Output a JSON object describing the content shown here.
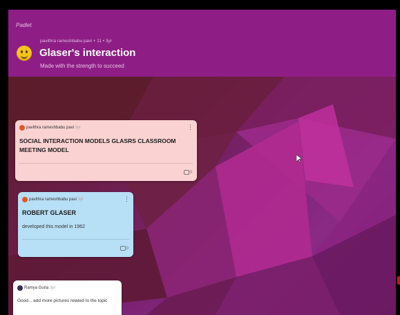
{
  "header": {
    "brand": "Padlet",
    "meta": "pavithra rameshbabu pavi + 11 • 3yr",
    "title": "Glaser's interaction",
    "subtitle": "Made with the strength to succeed"
  },
  "posts": [
    {
      "author": "pavithra rameshbabu pavi",
      "ago": "3yr",
      "heading": "SOCIAL INTERACTION MODELS GLASRS CLASSROOM MEETING MODEL",
      "body": "",
      "comments": "0",
      "color": "#fbd2d2"
    },
    {
      "author": "pavithra rameshbabu pavi",
      "ago": "3yr",
      "heading": "ROBERT GLASER",
      "body": "developed this model in 1962",
      "comments": "0",
      "color": "#b7dff5"
    },
    {
      "author": "Ramya Guna",
      "ago": "3yr",
      "heading": "",
      "body": "Good... add more pictures related to the topic",
      "comments": "",
      "color": "#ffffff"
    }
  ],
  "colors": {
    "header": "#8e1e86",
    "accent_dot": "#e2572a"
  },
  "icons": [
    "smiley-emoji-icon",
    "more-vertical-icon",
    "comment-icon",
    "cursor-icon"
  ]
}
